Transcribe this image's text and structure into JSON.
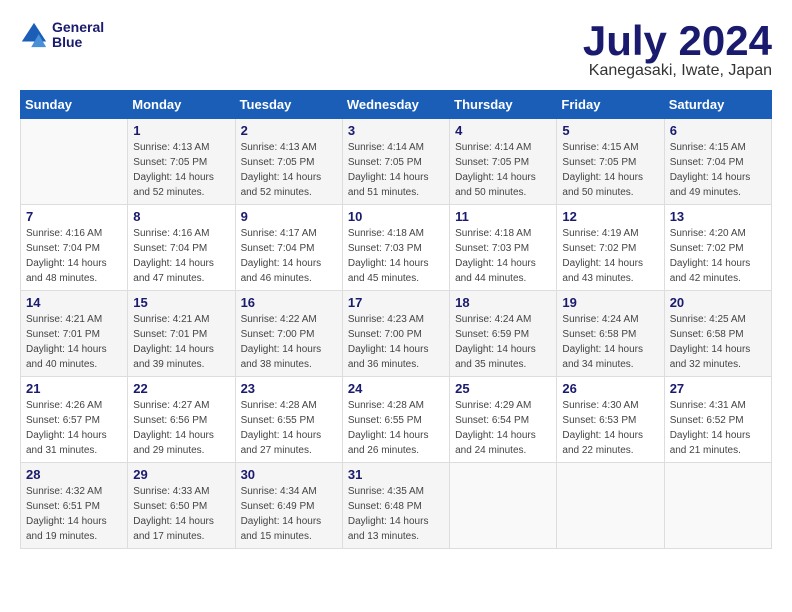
{
  "header": {
    "logo_line1": "General",
    "logo_line2": "Blue",
    "month_year": "July 2024",
    "location": "Kanegasaki, Iwate, Japan"
  },
  "weekdays": [
    "Sunday",
    "Monday",
    "Tuesday",
    "Wednesday",
    "Thursday",
    "Friday",
    "Saturday"
  ],
  "weeks": [
    [
      {
        "day": "",
        "info": ""
      },
      {
        "day": "1",
        "info": "Sunrise: 4:13 AM\nSunset: 7:05 PM\nDaylight: 14 hours\nand 52 minutes."
      },
      {
        "day": "2",
        "info": "Sunrise: 4:13 AM\nSunset: 7:05 PM\nDaylight: 14 hours\nand 52 minutes."
      },
      {
        "day": "3",
        "info": "Sunrise: 4:14 AM\nSunset: 7:05 PM\nDaylight: 14 hours\nand 51 minutes."
      },
      {
        "day": "4",
        "info": "Sunrise: 4:14 AM\nSunset: 7:05 PM\nDaylight: 14 hours\nand 50 minutes."
      },
      {
        "day": "5",
        "info": "Sunrise: 4:15 AM\nSunset: 7:05 PM\nDaylight: 14 hours\nand 50 minutes."
      },
      {
        "day": "6",
        "info": "Sunrise: 4:15 AM\nSunset: 7:04 PM\nDaylight: 14 hours\nand 49 minutes."
      }
    ],
    [
      {
        "day": "7",
        "info": "Sunrise: 4:16 AM\nSunset: 7:04 PM\nDaylight: 14 hours\nand 48 minutes."
      },
      {
        "day": "8",
        "info": "Sunrise: 4:16 AM\nSunset: 7:04 PM\nDaylight: 14 hours\nand 47 minutes."
      },
      {
        "day": "9",
        "info": "Sunrise: 4:17 AM\nSunset: 7:04 PM\nDaylight: 14 hours\nand 46 minutes."
      },
      {
        "day": "10",
        "info": "Sunrise: 4:18 AM\nSunset: 7:03 PM\nDaylight: 14 hours\nand 45 minutes."
      },
      {
        "day": "11",
        "info": "Sunrise: 4:18 AM\nSunset: 7:03 PM\nDaylight: 14 hours\nand 44 minutes."
      },
      {
        "day": "12",
        "info": "Sunrise: 4:19 AM\nSunset: 7:02 PM\nDaylight: 14 hours\nand 43 minutes."
      },
      {
        "day": "13",
        "info": "Sunrise: 4:20 AM\nSunset: 7:02 PM\nDaylight: 14 hours\nand 42 minutes."
      }
    ],
    [
      {
        "day": "14",
        "info": "Sunrise: 4:21 AM\nSunset: 7:01 PM\nDaylight: 14 hours\nand 40 minutes."
      },
      {
        "day": "15",
        "info": "Sunrise: 4:21 AM\nSunset: 7:01 PM\nDaylight: 14 hours\nand 39 minutes."
      },
      {
        "day": "16",
        "info": "Sunrise: 4:22 AM\nSunset: 7:00 PM\nDaylight: 14 hours\nand 38 minutes."
      },
      {
        "day": "17",
        "info": "Sunrise: 4:23 AM\nSunset: 7:00 PM\nDaylight: 14 hours\nand 36 minutes."
      },
      {
        "day": "18",
        "info": "Sunrise: 4:24 AM\nSunset: 6:59 PM\nDaylight: 14 hours\nand 35 minutes."
      },
      {
        "day": "19",
        "info": "Sunrise: 4:24 AM\nSunset: 6:58 PM\nDaylight: 14 hours\nand 34 minutes."
      },
      {
        "day": "20",
        "info": "Sunrise: 4:25 AM\nSunset: 6:58 PM\nDaylight: 14 hours\nand 32 minutes."
      }
    ],
    [
      {
        "day": "21",
        "info": "Sunrise: 4:26 AM\nSunset: 6:57 PM\nDaylight: 14 hours\nand 31 minutes."
      },
      {
        "day": "22",
        "info": "Sunrise: 4:27 AM\nSunset: 6:56 PM\nDaylight: 14 hours\nand 29 minutes."
      },
      {
        "day": "23",
        "info": "Sunrise: 4:28 AM\nSunset: 6:55 PM\nDaylight: 14 hours\nand 27 minutes."
      },
      {
        "day": "24",
        "info": "Sunrise: 4:28 AM\nSunset: 6:55 PM\nDaylight: 14 hours\nand 26 minutes."
      },
      {
        "day": "25",
        "info": "Sunrise: 4:29 AM\nSunset: 6:54 PM\nDaylight: 14 hours\nand 24 minutes."
      },
      {
        "day": "26",
        "info": "Sunrise: 4:30 AM\nSunset: 6:53 PM\nDaylight: 14 hours\nand 22 minutes."
      },
      {
        "day": "27",
        "info": "Sunrise: 4:31 AM\nSunset: 6:52 PM\nDaylight: 14 hours\nand 21 minutes."
      }
    ],
    [
      {
        "day": "28",
        "info": "Sunrise: 4:32 AM\nSunset: 6:51 PM\nDaylight: 14 hours\nand 19 minutes."
      },
      {
        "day": "29",
        "info": "Sunrise: 4:33 AM\nSunset: 6:50 PM\nDaylight: 14 hours\nand 17 minutes."
      },
      {
        "day": "30",
        "info": "Sunrise: 4:34 AM\nSunset: 6:49 PM\nDaylight: 14 hours\nand 15 minutes."
      },
      {
        "day": "31",
        "info": "Sunrise: 4:35 AM\nSunset: 6:48 PM\nDaylight: 14 hours\nand 13 minutes."
      },
      {
        "day": "",
        "info": ""
      },
      {
        "day": "",
        "info": ""
      },
      {
        "day": "",
        "info": ""
      }
    ]
  ]
}
